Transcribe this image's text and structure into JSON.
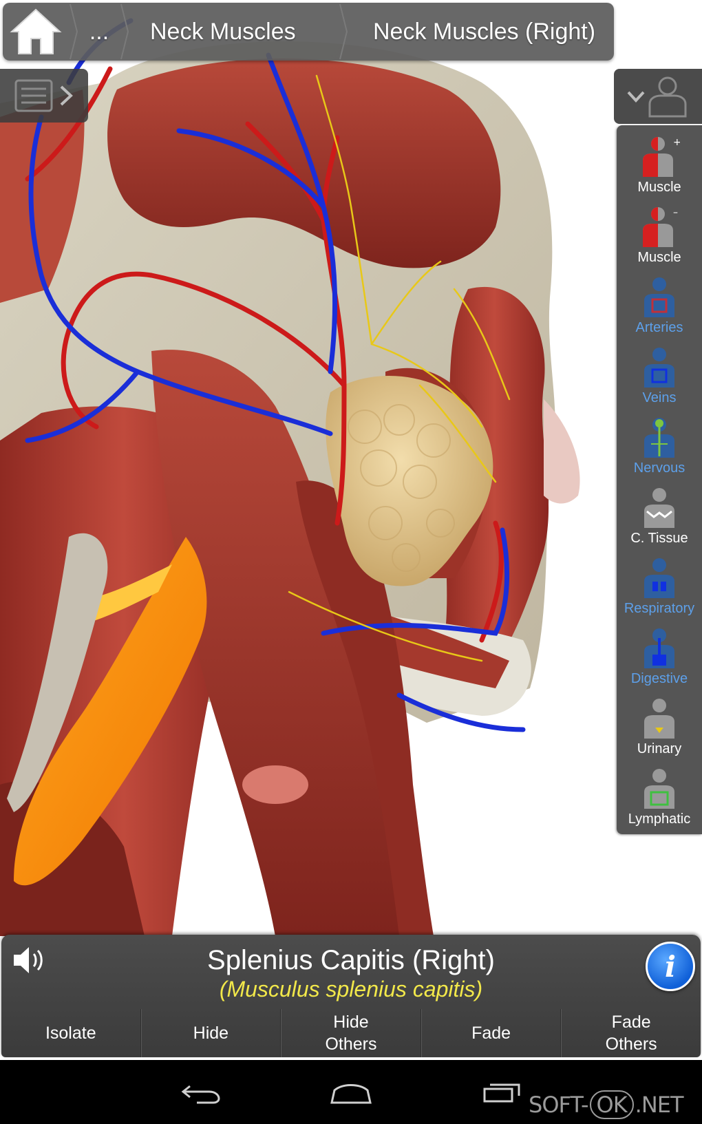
{
  "breadcrumb": {
    "ellipsis": "...",
    "items": [
      "Neck Muscles",
      "Neck Muscles (Right)"
    ]
  },
  "systems": [
    {
      "label": "Muscle",
      "icon": "muscle-add-icon",
      "active": true
    },
    {
      "label": "Muscle",
      "icon": "muscle-remove-icon",
      "active": true
    },
    {
      "label": "Arteries",
      "icon": "arteries-icon",
      "active": false
    },
    {
      "label": "Veins",
      "icon": "veins-icon",
      "active": false
    },
    {
      "label": "Nervous",
      "icon": "nervous-icon",
      "active": false
    },
    {
      "label": "C. Tissue",
      "icon": "connective-tissue-icon",
      "active": true
    },
    {
      "label": "Respiratory",
      "icon": "respiratory-icon",
      "active": false
    },
    {
      "label": "Digestive",
      "icon": "digestive-icon",
      "active": false
    },
    {
      "label": "Urinary",
      "icon": "urinary-icon",
      "active": true
    },
    {
      "label": "Lymphatic",
      "icon": "lymphatic-icon",
      "active": true
    }
  ],
  "selection": {
    "name": "Splenius Capitis (Right)",
    "latin": "(Musculus splenius capitis)"
  },
  "actions": [
    "Isolate",
    "Hide",
    "Hide\nOthers",
    "Fade",
    "Fade\nOthers"
  ],
  "watermark": {
    "prefix": "SOFT-",
    "ok": "OK",
    "suffix": ".NET"
  },
  "colors": {
    "highlight": "#ff8a00",
    "muscle": "#a8352a",
    "artery": "#cc1a1a",
    "vein": "#1a2ed8",
    "nerve": "#e8c818",
    "gland": "#e8cf96",
    "inactive_label": "#5da0ea",
    "latin_text": "#f2e84a"
  }
}
